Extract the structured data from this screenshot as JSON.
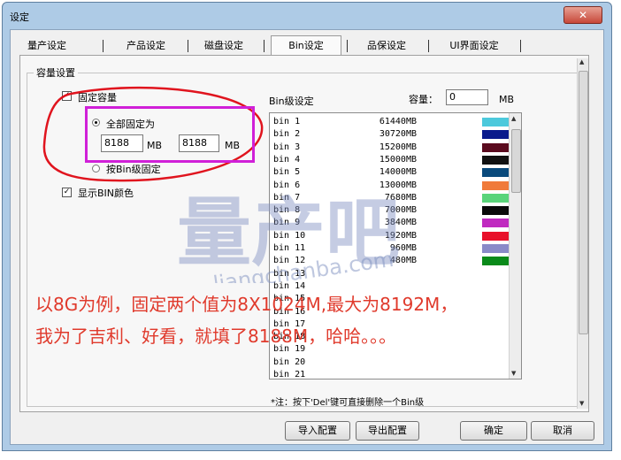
{
  "window": {
    "title": "设定",
    "close_glyph": "✕"
  },
  "tabs": [
    {
      "label": "量产设定"
    },
    {
      "label": "产品设定"
    },
    {
      "label": "磁盘设定"
    },
    {
      "label": "Bin设定"
    },
    {
      "label": "品保设定"
    },
    {
      "label": "UI界面设定"
    }
  ],
  "capacity_group": {
    "label": "容量设置",
    "fixed_capacity": {
      "label": "固定容量",
      "checked": true
    },
    "all_fixed": {
      "label": "全部固定为",
      "selected": true
    },
    "value1": "8188",
    "unit1": "MB",
    "value2": "8188",
    "unit2": "MB",
    "by_bin": {
      "label": "按Bin级固定",
      "selected": false
    },
    "show_bin_color": {
      "label": "显示BIN颜色",
      "checked": true
    }
  },
  "bin_settings": {
    "label": "Bin级设定",
    "capacity_label": "容量：",
    "capacity_value": "0",
    "capacity_unit": "MB",
    "rows": [
      {
        "name": "bin 1",
        "value": "61440MB",
        "color": "#4cc9dc"
      },
      {
        "name": "bin 2",
        "value": "30720MB",
        "color": "#0a1a8c"
      },
      {
        "name": "bin 3",
        "value": "15200MB",
        "color": "#5a0a1e"
      },
      {
        "name": "bin 4",
        "value": "15000MB",
        "color": "#111111"
      },
      {
        "name": "bin 5",
        "value": "14000MB",
        "color": "#0a4a7c"
      },
      {
        "name": "bin 6",
        "value": "13000MB",
        "color": "#f07a3a"
      },
      {
        "name": "bin 7",
        "value": "7680MB",
        "color": "#5ad47a"
      },
      {
        "name": "bin 8",
        "value": "7000MB",
        "color": "#0a0a0a"
      },
      {
        "name": "bin 9",
        "value": "3840MB",
        "color": "#c02ac0"
      },
      {
        "name": "bin 10",
        "value": "1920MB",
        "color": "#e8102a"
      },
      {
        "name": "bin 11",
        "value": "960MB",
        "color": "#8a8ac8"
      },
      {
        "name": "bin 12",
        "value": "480MB",
        "color": "#0a8a1a"
      },
      {
        "name": "bin 13",
        "value": "",
        "color": ""
      },
      {
        "name": "bin 14",
        "value": "",
        "color": ""
      },
      {
        "name": "bin 15",
        "value": "",
        "color": ""
      },
      {
        "name": "bin 16",
        "value": "",
        "color": ""
      },
      {
        "name": "bin 17",
        "value": "",
        "color": ""
      },
      {
        "name": "bin 18",
        "value": "",
        "color": ""
      },
      {
        "name": "bin 19",
        "value": "",
        "color": ""
      },
      {
        "name": "bin 20",
        "value": "",
        "color": ""
      },
      {
        "name": "bin 21",
        "value": "",
        "color": ""
      }
    ],
    "note": "*注：按下'Del'键可直接删除一个Bin级"
  },
  "buttons": {
    "import": "导入配置",
    "export": "导出配置",
    "ok": "确定",
    "cancel": "取消"
  },
  "watermark": {
    "logo_text": "量产吧",
    "url_text": "liangchanba.com"
  },
  "annotation": {
    "line1": "以8G为例，固定两个值为8X1024M,最大为8192M，",
    "line2": "我为了吉利、好看，就填了8188M，哈哈。。。",
    "color": "#e03a2c",
    "ellipse_color": "#e0141e",
    "box_color": "#d020d8"
  }
}
